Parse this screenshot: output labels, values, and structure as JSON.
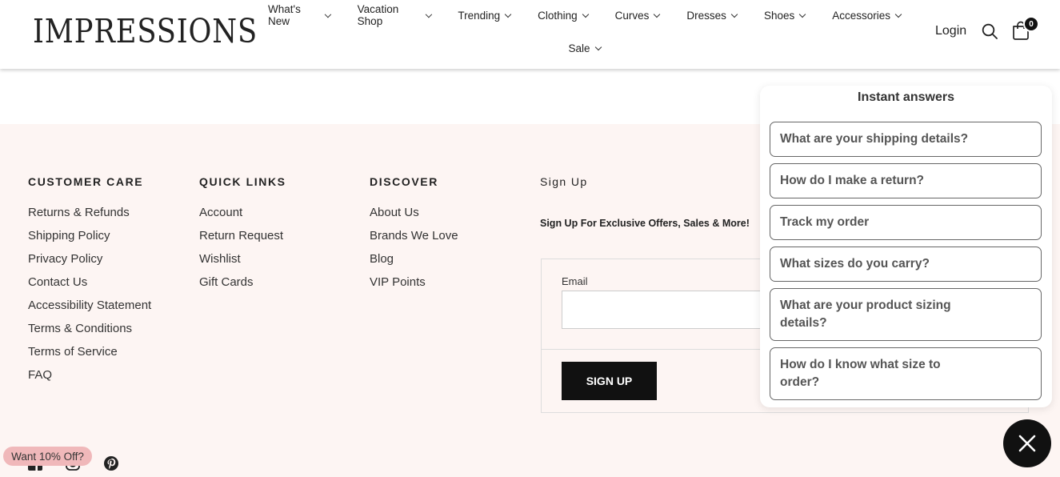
{
  "header": {
    "logo": "IMPRESSIONS",
    "nav_row1": [
      "What's New",
      "Vacation Shop",
      "Trending",
      "Clothing",
      "Curves",
      "Dresses",
      "Shoes",
      "Accessories"
    ],
    "nav_row2": [
      "Sale"
    ],
    "login": "Login",
    "cart_count": "0"
  },
  "footer": {
    "customer_care": {
      "title": "CUSTOMER CARE",
      "links": [
        "Returns & Refunds",
        "Shipping Policy",
        "Privacy Policy",
        "Contact Us",
        "Accessibility Statement",
        "Terms & Conditions",
        "Terms of Service",
        "FAQ"
      ]
    },
    "quick_links": {
      "title": "QUICK LINKS",
      "links": [
        "Account",
        "Return Request",
        "Wishlist",
        "Gift Cards"
      ]
    },
    "discover": {
      "title": "DISCOVER",
      "links": [
        "About Us",
        "Brands We Love",
        "Blog",
        "VIP Points"
      ]
    },
    "signup": {
      "title": "Sign Up",
      "subtitle": "Sign Up For Exclusive Offers, Sales & More!",
      "email_label": "Email",
      "email_value": "",
      "button": "SIGN UP"
    },
    "social_icons": [
      "facebook-icon",
      "instagram-icon",
      "pinterest-icon"
    ]
  },
  "promo": "Want 10% Off?",
  "chat": {
    "title": "Instant answers",
    "questions": [
      "What are your shipping details?",
      "How do I make a return?",
      "Track my order",
      "What sizes do you carry?",
      "What are your product sizing details?",
      "How do I know what size to order?"
    ]
  },
  "colors": {
    "footer_bg": "#fdf5f3",
    "accent": "#111111",
    "promo_bg": "#f0b8ba"
  }
}
